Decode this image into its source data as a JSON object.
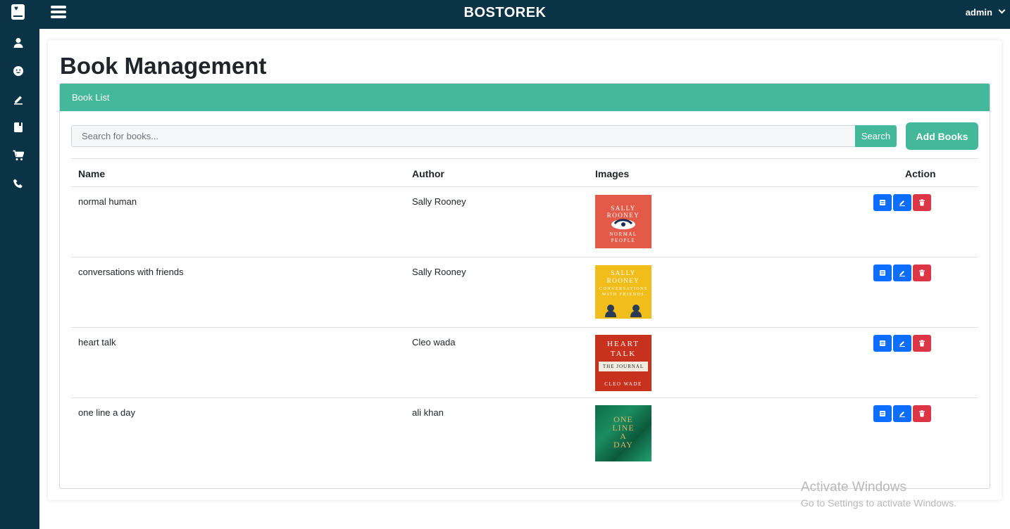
{
  "app": {
    "brand": "BOSTOREK",
    "user": "admin"
  },
  "colors": {
    "nav": "#0b3346",
    "accent": "#44b89a",
    "primary": "#0d6efd",
    "danger": "#dc3545"
  },
  "sidebar": {
    "icons": [
      "user-icon",
      "smiley-icon",
      "edit-icon",
      "book-icon",
      "cart-icon",
      "phone-icon"
    ]
  },
  "page": {
    "title": "Book Management"
  },
  "panel": {
    "header": "Book List"
  },
  "search": {
    "placeholder": "Search for books...",
    "button": "Search"
  },
  "add_button": "Add Books",
  "table": {
    "headers": {
      "name": "Name",
      "author": "Author",
      "images": "Images",
      "action": "Action"
    },
    "rows": [
      {
        "name": "normal human",
        "author": "Sally Rooney",
        "cover": {
          "top": "SALLY ROONEY",
          "bottom": "NORMAL PEOPLE"
        }
      },
      {
        "name": "conversations with friends",
        "author": "Sally Rooney",
        "cover": {
          "top": "SALLY ROONEY",
          "bottom": "CONVERSATIONS WITH FRIENDS"
        }
      },
      {
        "name": "heart talk",
        "author": "Cleo wada",
        "cover": {
          "top": "HEART TALK",
          "middle": "THE JOURNAL",
          "bottom": "CLEO WADE"
        }
      },
      {
        "name": "one line a day",
        "author": "ali khan",
        "cover": {
          "top": "ONE LINE A DAY"
        }
      }
    ]
  },
  "watermark": {
    "line1": "Activate Windows",
    "line2": "Go to Settings to activate Windows."
  }
}
